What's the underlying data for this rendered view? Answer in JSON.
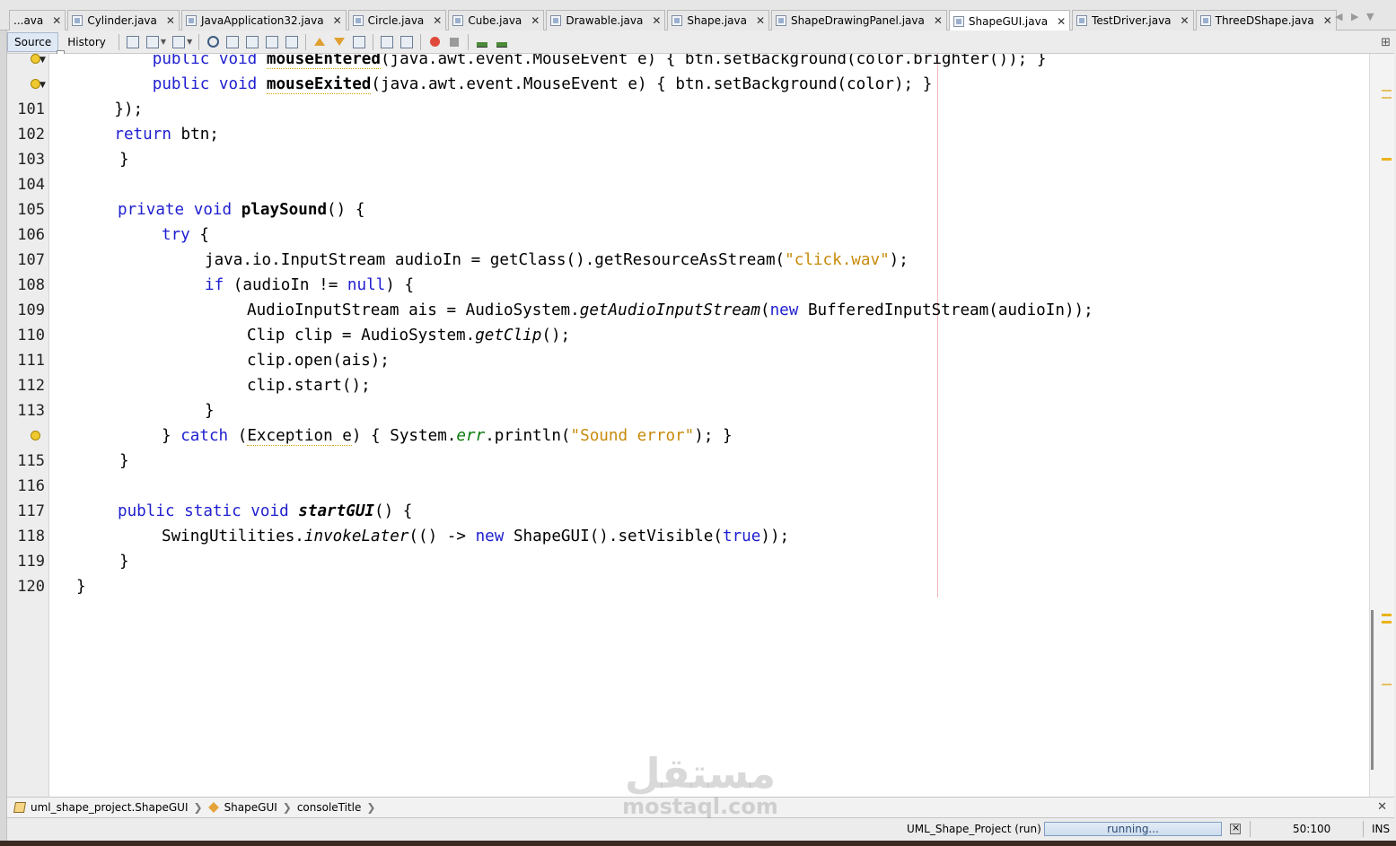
{
  "tabs": [
    {
      "label": "...ava",
      "active": false
    },
    {
      "label": "Cylinder.java",
      "active": false
    },
    {
      "label": "JavaApplication32.java",
      "active": false
    },
    {
      "label": "Circle.java",
      "active": false
    },
    {
      "label": "Cube.java",
      "active": false
    },
    {
      "label": "Drawable.java",
      "active": false
    },
    {
      "label": "Shape.java",
      "active": false
    },
    {
      "label": "ShapeDrawingPanel.java",
      "active": false
    },
    {
      "label": "ShapeGUI.java",
      "active": true
    },
    {
      "label": "TestDriver.java",
      "active": false
    },
    {
      "label": "ThreeDShape.java",
      "active": false
    }
  ],
  "tab_close_glyph": "✕",
  "nav": {
    "prev": "◀",
    "next": "▶",
    "list": "▼"
  },
  "toolbar": {
    "source_label": "Source",
    "history_label": "History",
    "active_mode": "Source"
  },
  "editor": {
    "line_numbers": [
      "",
      "",
      "101",
      "102",
      "103",
      "104",
      "105",
      "106",
      "107",
      "108",
      "109",
      "110",
      "111",
      "112",
      "113",
      "",
      "115",
      "116",
      "117",
      "118",
      "119",
      "120"
    ],
    "code": {
      "l99_pre": "        public void ",
      "l99_method": "mouseEntered",
      "l99_post": "(java.awt.event.MouseEvent e) { btn.setBackground(color.brighter()); }",
      "l100_pre": "        public void ",
      "l100_method": "mouseExited",
      "l100_post": "(java.awt.event.MouseEvent e) { btn.setBackground(color); }",
      "l101": "    });",
      "l102_kw": "return",
      "l102_rest": " btn;",
      "l103": "}",
      "l105_kw": "private void",
      "l105_method": "playSound",
      "l105_rest": "() {",
      "l106_kw": "try",
      "l106_rest": " {",
      "l107_pre": "java.io.InputStream audioIn = getClass().getResourceAsStream(",
      "l107_str": "\"click.wav\"",
      "l107_post": ");",
      "l108_kw": "if",
      "l108_mid": " (audioIn != ",
      "l108_null": "null",
      "l108_post": ") {",
      "l109_pre": "AudioInputStream ais = AudioSystem.",
      "l109_italic": "getAudioInputStream",
      "l109_mid": "(",
      "l109_new": "new",
      "l109_post": " BufferedInputStream(audioIn));",
      "l110_pre": "Clip clip = AudioSystem.",
      "l110_italic": "getClip",
      "l110_post": "();",
      "l111": "clip.open(ais);",
      "l112": "clip.start();",
      "l113": "}",
      "l114_pre": "} ",
      "l114_kw": "catch",
      "l114_mid": " (",
      "l114_exc": "Exception",
      "l114_var": " e",
      "l114_rest": ") { System.",
      "l114_err": "err",
      "l114_print": ".println(",
      "l114_str": "\"Sound error\"",
      "l114_end": "); }",
      "l115": "}",
      "l117_kw": "public static void",
      "l117_method": "startGUI",
      "l117_rest": "() {",
      "l118_pre": "SwingUtilities.",
      "l118_italic": "invokeLater",
      "l118_mid": "(() -> ",
      "l118_new": "new",
      "l118_mid2": " ShapeGUI().setVisible(",
      "l118_true": "true",
      "l118_post": "));",
      "l119": "}",
      "l120": "}"
    },
    "colors": {
      "keyword": "#1e1ed0",
      "string": "#c88a0a",
      "field": "#0a7a0a",
      "margin_line": "#f2b9b9",
      "warning": "#e9b319"
    }
  },
  "breadcrumb": [
    "uml_shape_project.ShapeGUI",
    "ShapeGUI",
    "consoleTitle"
  ],
  "breadcrumb_sep": "❯",
  "breadcrumb_close": "✕",
  "status": {
    "project": "UML_Shape_Project (run)",
    "progress_text": "running...",
    "caret": "50:100",
    "insert_mode": "INS"
  },
  "watermark": {
    "arabic": "مستقل",
    "latin": "mostaql.com"
  }
}
